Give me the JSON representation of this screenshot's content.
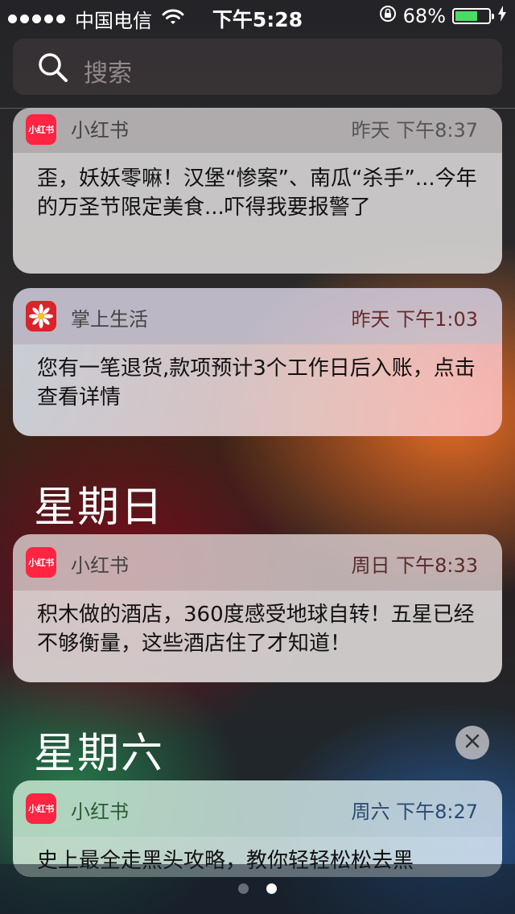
{
  "status_bar": {
    "carrier": "中国电信",
    "time": "下午5:28",
    "battery_percent": "68%",
    "battery_level": 0.68,
    "signal_bars": 5
  },
  "search": {
    "placeholder": "搜索"
  },
  "notifications": [
    {
      "app": "小红书",
      "app_icon_text": "小红书",
      "time": "昨天 下午8:37",
      "message": "歪，妖妖零嘛！汉堡“惨案”、南瓜“杀手”...今年的万圣节限定美食...吓得我要报警了"
    },
    {
      "app": "掌上生活",
      "time": "昨天 下午1:03",
      "message": "您有一笔退货,款项预计3个工作日后入账，点击查看详情"
    },
    {
      "app": "小红书",
      "app_icon_text": "小红书",
      "time": "周日 下午8:33",
      "message": "积木做的酒店，360度感受地球自转！五星已经不够衡量，这些酒店住了才知道！"
    },
    {
      "app": "小红书",
      "app_icon_text": "小红书",
      "time": "周六 下午8:27",
      "message": "史上最全走黑头攻略，教你轻轻松松去黑"
    }
  ],
  "sections": {
    "sunday": "星期日",
    "saturday": "星期六"
  },
  "colors": {
    "xiaohongshu_red": "#ff2442",
    "zhangshang_red": "#d8242a",
    "battery_green": "#4cd964"
  },
  "pages": {
    "count": 2,
    "active": 2
  }
}
